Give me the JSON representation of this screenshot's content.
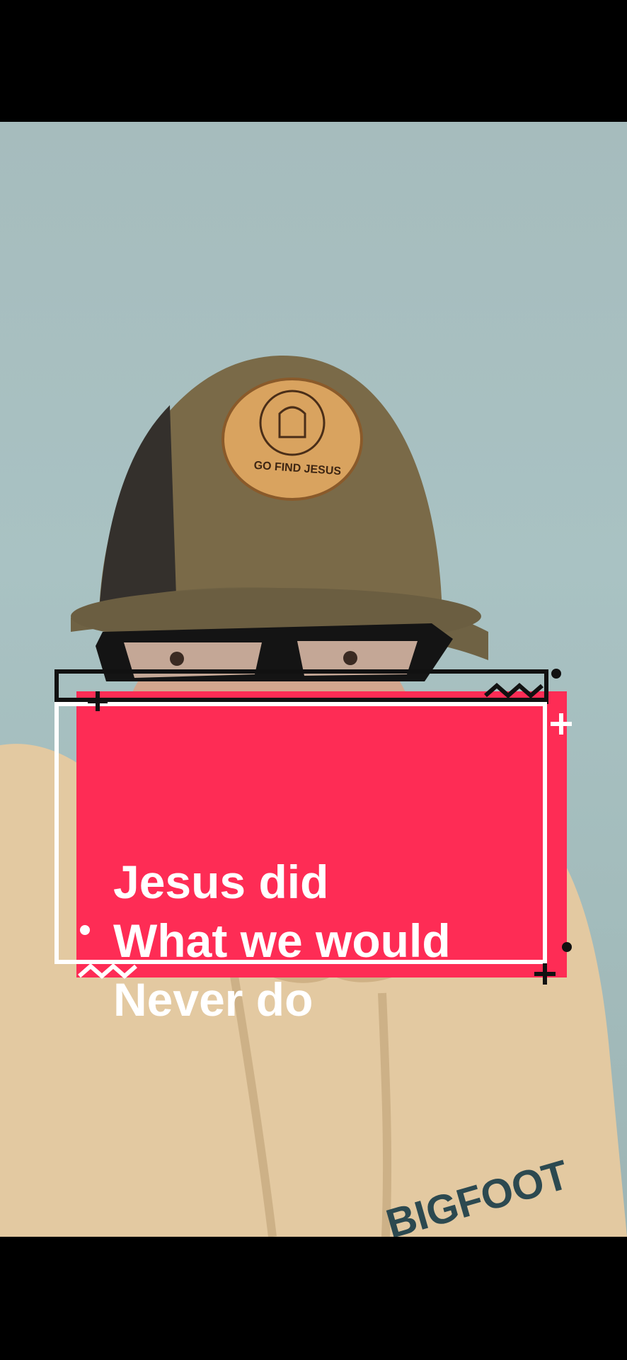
{
  "caption": {
    "lines": [
      "Jesus did",
      "What we would",
      "Never do"
    ]
  },
  "hat_patch": {
    "text": "GO FIND JESUS"
  },
  "hoodie_print": {
    "text": "BIGFOOT"
  },
  "colors": {
    "caption_bg": "#fe2c55",
    "frame_dark": "#111111",
    "frame_light": "#ffffff",
    "wall": "#a8c0c1",
    "cap": "#7a6a48",
    "patch": "#d9a35f",
    "hoodie": "#e3c9a1"
  }
}
